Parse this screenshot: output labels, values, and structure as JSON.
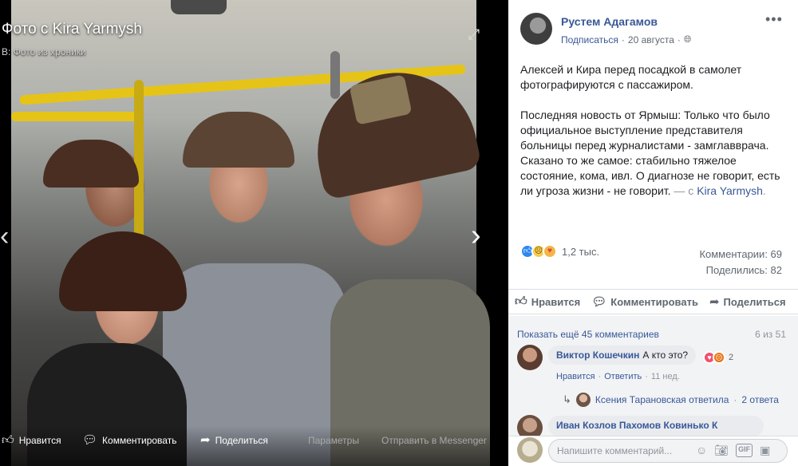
{
  "viewer": {
    "title": "Фото с Kira Yarmysh",
    "subtitle": "В: Фото из хроники",
    "bottom_actions": [
      {
        "label": "Нравится",
        "icon": "like-icon"
      },
      {
        "label": "Комментировать",
        "icon": "comment-icon"
      },
      {
        "label": "Поделиться",
        "icon": "share-icon"
      },
      {
        "label": "Параметры"
      },
      {
        "label": "Отправить в Messenger"
      }
    ]
  },
  "post": {
    "author": "Рустем Адагамов",
    "follow": "Подписаться",
    "date": "20 августа",
    "text_p1": "Алексей и Кира перед посадкой в самолет фотографируются с пассажиром.",
    "text_p2": "Последняя новость от Ярмыш: Только что было официальное выступление представителя больницы перед журналистами - замглавврача. Сказано то же самое: стабильно тяжелое состояние, кома, ивл. О диагнозе не говорит, есть ли угроза жизни - не говорит.",
    "with_prefix": "— с",
    "with_name": "Kira Yarmysh",
    "reactions_count": "1,2 тыс.",
    "comments_stat": "Комментарии: 69",
    "shares_stat": "Поделились: 82",
    "actions": {
      "like": "Нравится",
      "comment": "Комментировать",
      "share": "Поделиться"
    }
  },
  "comments": {
    "more_label": "Показать ещё 45 комментариев",
    "count": "6 из 51",
    "first": {
      "author": "Виктор Кошечкин",
      "text": "А кто это?",
      "reaction_count": "2",
      "like": "Нравится",
      "reply": "Ответить",
      "time": "11 нед."
    },
    "reply_summary": {
      "text": "Ксения Тарановская ответила",
      "count": "2 ответа"
    },
    "second_author_partial": "Иван Козлов Пахомов Ковинько К"
  },
  "composer": {
    "placeholder": "Напишите комментарий..."
  },
  "colors": {
    "link": "#385898",
    "secondary_text": "#606770",
    "like_blue": "#2d87f0"
  }
}
